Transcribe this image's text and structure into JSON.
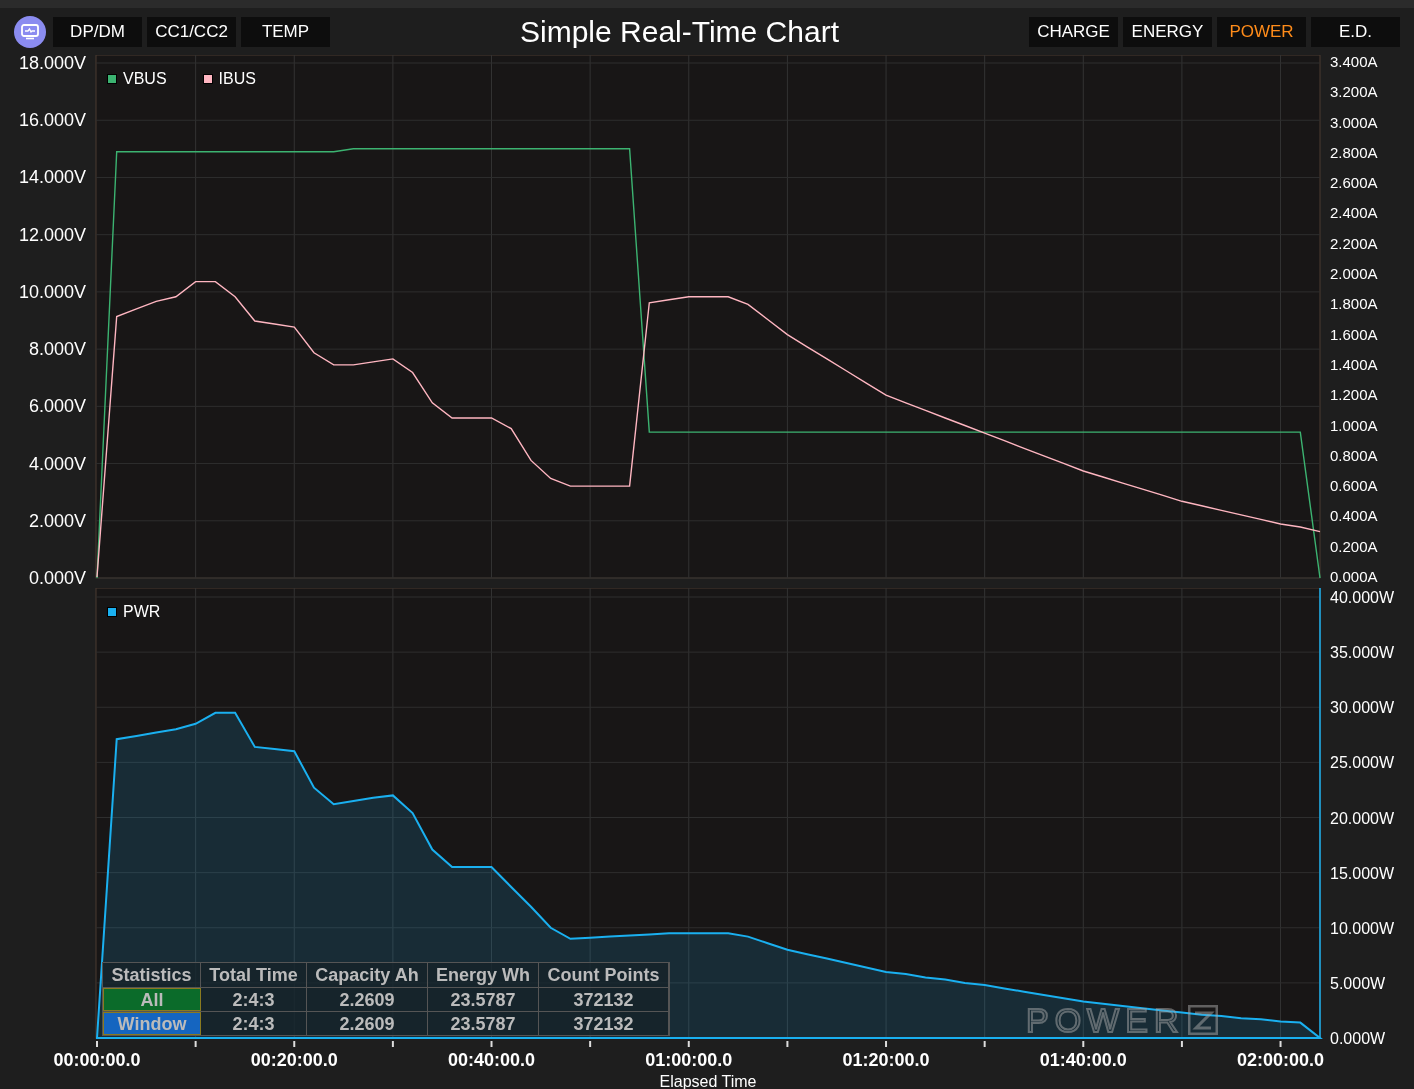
{
  "header": {
    "title": "Simple Real-Time Chart",
    "left_buttons": [
      {
        "label": "DP/DM",
        "selected": false
      },
      {
        "label": "CC1/CC2",
        "selected": false
      },
      {
        "label": "TEMP",
        "selected": false
      }
    ],
    "right_buttons": [
      {
        "label": "CHARGE",
        "selected": false
      },
      {
        "label": "ENERGY",
        "selected": false
      },
      {
        "label": "POWER",
        "selected": true
      },
      {
        "label": "E.D.",
        "selected": false
      }
    ]
  },
  "voltage_chart": {
    "chart_data": {
      "type": "line",
      "grid": true,
      "legend": true,
      "categories": [
        null,
        null,
        null,
        null,
        null,
        null,
        null,
        null,
        null,
        null,
        null,
        null,
        null,
        null,
        null,
        null,
        null,
        null,
        null,
        null,
        null,
        null,
        null,
        null,
        null,
        null,
        null,
        null,
        null,
        null,
        null,
        null,
        null,
        null,
        null,
        null,
        null,
        null,
        null,
        null,
        null,
        null,
        null,
        null,
        null,
        null,
        null,
        null,
        null,
        null,
        null,
        null,
        null,
        null,
        null,
        null,
        null,
        null,
        null,
        null,
        null,
        null,
        null
      ],
      "ylim": [
        0,
        18
      ],
      "yticks": [
        {
          "value": 0,
          "label": "0.000V"
        },
        {
          "value": 2,
          "label": "2.000V"
        },
        {
          "value": 4,
          "label": "4.000V"
        },
        {
          "value": 6,
          "label": "6.000V"
        },
        {
          "value": 8,
          "label": "8.000V"
        },
        {
          "value": 10,
          "label": "10.000V"
        },
        {
          "value": 12,
          "label": "12.000V"
        },
        {
          "value": 14,
          "label": "14.000V"
        },
        {
          "value": 16,
          "label": "16.000V"
        },
        {
          "value": 18,
          "label": "18.000V"
        }
      ],
      "y2lim": [
        0,
        3.4
      ],
      "y2ticks": [
        {
          "value": 3.4,
          "label": "3.400A"
        },
        {
          "value": 3.2,
          "label": "3.200A"
        },
        {
          "value": 3.0,
          "label": "3.000A"
        },
        {
          "value": 2.8,
          "label": "2.800A"
        },
        {
          "value": 2.6,
          "label": "2.600A"
        },
        {
          "value": 2.4,
          "label": "2.400A"
        },
        {
          "value": 2.2,
          "label": "2.200A"
        },
        {
          "value": 2.0,
          "label": "2.000A"
        },
        {
          "value": 1.8,
          "label": "1.800A"
        },
        {
          "value": 1.6,
          "label": "1.600A"
        },
        {
          "value": 1.4,
          "label": "1.400A"
        },
        {
          "value": 1.2,
          "label": "1.200A"
        },
        {
          "value": 1.0,
          "label": "1.000A"
        },
        {
          "value": 0.8,
          "label": "0.800A"
        },
        {
          "value": 0.6,
          "label": "0.600A"
        },
        {
          "value": 0.4,
          "label": "0.400A"
        },
        {
          "value": 0.2,
          "label": "0.200A"
        },
        {
          "value": 0,
          "label": "0.000A"
        }
      ],
      "series": [
        {
          "name": "VBUS",
          "color": "#3cb371",
          "values": [
            0,
            14.9,
            14.9,
            14.9,
            14.9,
            14.9,
            14.9,
            14.9,
            14.9,
            14.9,
            14.9,
            14.9,
            14.9,
            15,
            15,
            15,
            15,
            15,
            15,
            15,
            15,
            15,
            15,
            15,
            15,
            15,
            15,
            15,
            5.1,
            5.1,
            5.1,
            5.1,
            5.1,
            5.1,
            5.1,
            5.1,
            5.1,
            5.1,
            5.1,
            5.1,
            5.1,
            5.1,
            5.1,
            5.1,
            5.1,
            5.1,
            5.1,
            5.1,
            5.1,
            5.1,
            5.1,
            5.1,
            5.1,
            5.1,
            5.1,
            5.1,
            5.1,
            5.1,
            5.1,
            5.1,
            5.1,
            5.1,
            0
          ]
        },
        {
          "name": "IBUS",
          "color": "#ffb6c1",
          "axis": "y2",
          "values": [
            0,
            1.72,
            1.77,
            1.82,
            1.85,
            1.95,
            1.95,
            1.85,
            1.69,
            1.67,
            1.65,
            1.48,
            1.4,
            1.4,
            1.42,
            1.44,
            1.35,
            1.15,
            1.05,
            1.05,
            1.05,
            0.98,
            0.77,
            0.65,
            0.6,
            0.6,
            0.6,
            0.6,
            1.81,
            1.83,
            1.85,
            1.85,
            1.85,
            1.8,
            1.7,
            1.6,
            1.52,
            1.44,
            1.36,
            1.28,
            1.2,
            1.15,
            1.1,
            1.05,
            1.0,
            0.95,
            0.9,
            0.85,
            0.8,
            0.75,
            0.7,
            0.66,
            0.62,
            0.58,
            0.54,
            0.5,
            0.47,
            0.44,
            0.41,
            0.38,
            0.35,
            0.33,
            0.3
          ]
        }
      ]
    }
  },
  "power_chart": {
    "chart_data": {
      "type": "area",
      "grid": true,
      "legend": true,
      "xlabel": "Elapsed Time",
      "categories": [
        "00:00:00.0",
        null,
        null,
        null,
        null,
        null,
        null,
        null,
        null,
        null,
        "00:20:00.0",
        null,
        null,
        null,
        null,
        null,
        null,
        null,
        null,
        null,
        "00:40:00.0",
        null,
        null,
        null,
        null,
        null,
        null,
        null,
        null,
        null,
        "01:00:00.0",
        null,
        null,
        null,
        null,
        null,
        null,
        null,
        null,
        null,
        "01:20:00.0",
        null,
        null,
        null,
        null,
        null,
        null,
        null,
        null,
        null,
        "01:40:00.0",
        null,
        null,
        null,
        null,
        null,
        null,
        null,
        null,
        null,
        "02:00:00.0",
        null,
        null
      ],
      "ylim": [
        0,
        40
      ],
      "yticks": [
        {
          "value": 0,
          "label": "0.000W"
        },
        {
          "value": 5,
          "label": "5.000W"
        },
        {
          "value": 10,
          "label": "10.000W"
        },
        {
          "value": 15,
          "label": "15.000W"
        },
        {
          "value": 20,
          "label": "20.000W"
        },
        {
          "value": 25,
          "label": "25.000W"
        },
        {
          "value": 30,
          "label": "30.000W"
        },
        {
          "value": 35,
          "label": "35.000W"
        },
        {
          "value": 40,
          "label": "40.000W"
        }
      ],
      "series": [
        {
          "name": "PWR",
          "color": "#1ab0f0",
          "values": [
            0,
            27.1,
            27.4,
            27.7,
            28,
            28.5,
            29.5,
            29.5,
            26.4,
            26.2,
            26,
            22.7,
            21.2,
            21.5,
            21.8,
            22,
            20.4,
            17.1,
            15.5,
            15.5,
            15.5,
            13.7,
            11.9,
            10,
            9,
            9.1,
            9.2,
            9.3,
            9.4,
            9.5,
            9.5,
            9.5,
            9.5,
            9.2,
            8.6,
            8,
            7.6,
            7.2,
            6.8,
            6.4,
            6,
            5.8,
            5.5,
            5.3,
            5,
            4.8,
            4.5,
            4.2,
            3.9,
            3.6,
            3.3,
            3.1,
            2.9,
            2.7,
            2.5,
            2.3,
            2.1,
            2,
            1.8,
            1.7,
            1.5,
            1.4,
            0
          ]
        }
      ]
    }
  },
  "statistics": {
    "columns": [
      "Statistics",
      "Total Time",
      "Capacity Ah",
      "Energy Wh",
      "Count Points"
    ],
    "rows": [
      {
        "color": "#0b6b2a",
        "cells": [
          "All",
          "2:4:3",
          "2.2609",
          "23.5787",
          "372132"
        ]
      },
      {
        "color": "#1565c0",
        "cells": [
          "Window",
          "2:4:3",
          "2.2609",
          "23.5787",
          "372132"
        ]
      }
    ]
  },
  "logo_text": "POWER"
}
